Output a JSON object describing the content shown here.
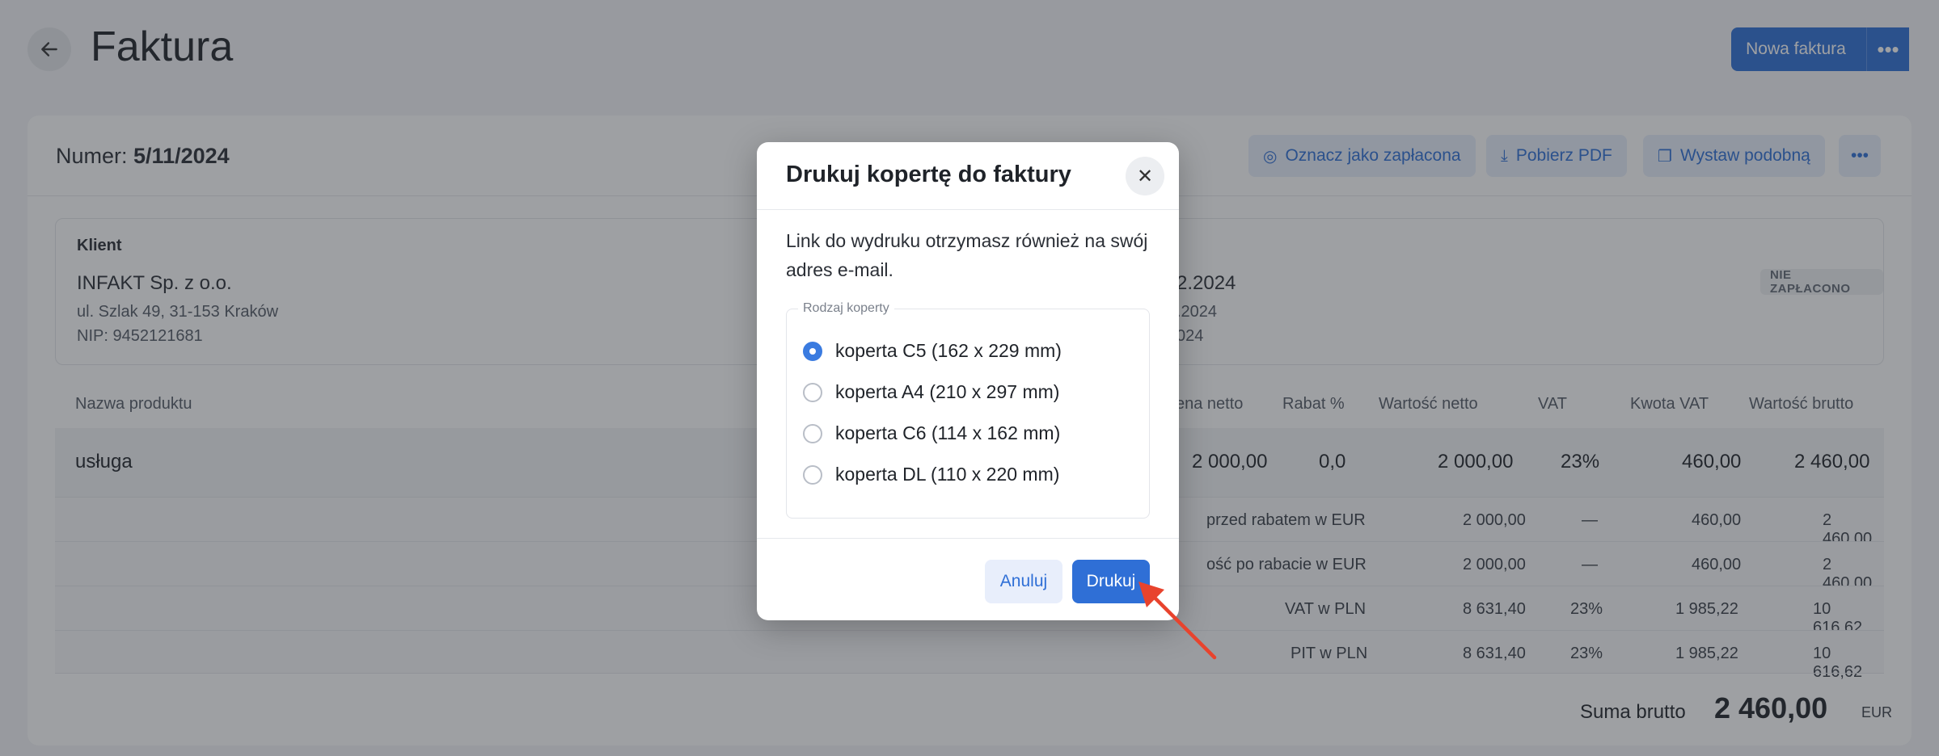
{
  "header": {
    "title": "Faktura",
    "new_invoice_label": "Nowa faktura",
    "more_icon": "ellipsis-icon"
  },
  "invoice": {
    "number_label": "Numer:",
    "number_value": "5/11/2024",
    "actions": {
      "mark_paid": "Oznacz jako zapłacona",
      "download_pdf": "Pobierz PDF",
      "issue_similar": "Wystaw podobną"
    },
    "client": {
      "label": "Klient",
      "name": "INFAKT Sp. z o.o.",
      "address": "ul. Szlak 49, 31-153 Kraków",
      "nip": "NIP: 9452121681"
    },
    "dates": {
      "line1": "2.2024",
      "line2": ".2024",
      "line3": "024"
    },
    "status_badge": "NIE ZAPŁACONO"
  },
  "table": {
    "headers": {
      "product": "Nazwa produktu",
      "net_price": "ena netto",
      "discount": "Rabat %",
      "net_value": "Wartość netto",
      "vat": "VAT",
      "vat_amount": "Kwota VAT",
      "gross_value": "Wartość brutto"
    },
    "row": {
      "product": "usługa",
      "net_price": "2 000,00",
      "discount": "0,0",
      "net_value": "2 000,00",
      "vat": "23%",
      "vat_amount": "460,00",
      "gross_value": "2 460,00"
    },
    "summary": [
      {
        "label": "przed rabatem w EUR",
        "net_value": "2 000,00",
        "vat": "—",
        "vat_amount": "460,00",
        "gross_value": "2 460,00"
      },
      {
        "label": "ość po rabacie w EUR",
        "net_value": "2 000,00",
        "vat": "—",
        "vat_amount": "460,00",
        "gross_value": "2 460,00"
      },
      {
        "label": "VAT w PLN",
        "net_value": "8 631,40",
        "vat": "23%",
        "vat_amount": "1 985,22",
        "gross_value": "10 616,62"
      },
      {
        "label": "PIT w PLN",
        "net_value": "8 631,40",
        "vat": "23%",
        "vat_amount": "1 985,22",
        "gross_value": "10 616,62"
      }
    ],
    "total_label": "Suma brutto",
    "total_value": "2 460,00",
    "total_currency": "EUR"
  },
  "modal": {
    "title": "Drukuj kopertę do faktury",
    "info": "Link do wydruku otrzymasz również na swój adres e-mail.",
    "fieldset_legend": "Rodzaj koperty",
    "options": [
      {
        "label": "koperta C5 (162 x 229 mm)",
        "selected": true
      },
      {
        "label": "koperta A4 (210 x 297 mm)",
        "selected": false
      },
      {
        "label": "koperta C6 (114 x 162 mm)",
        "selected": false
      },
      {
        "label": "koperta DL (110 x 220 mm)",
        "selected": false
      }
    ],
    "cancel_label": "Anuluj",
    "print_label": "Drukuj"
  },
  "colors": {
    "accent": "#2f6fd6",
    "arrow": "#e8432d"
  }
}
